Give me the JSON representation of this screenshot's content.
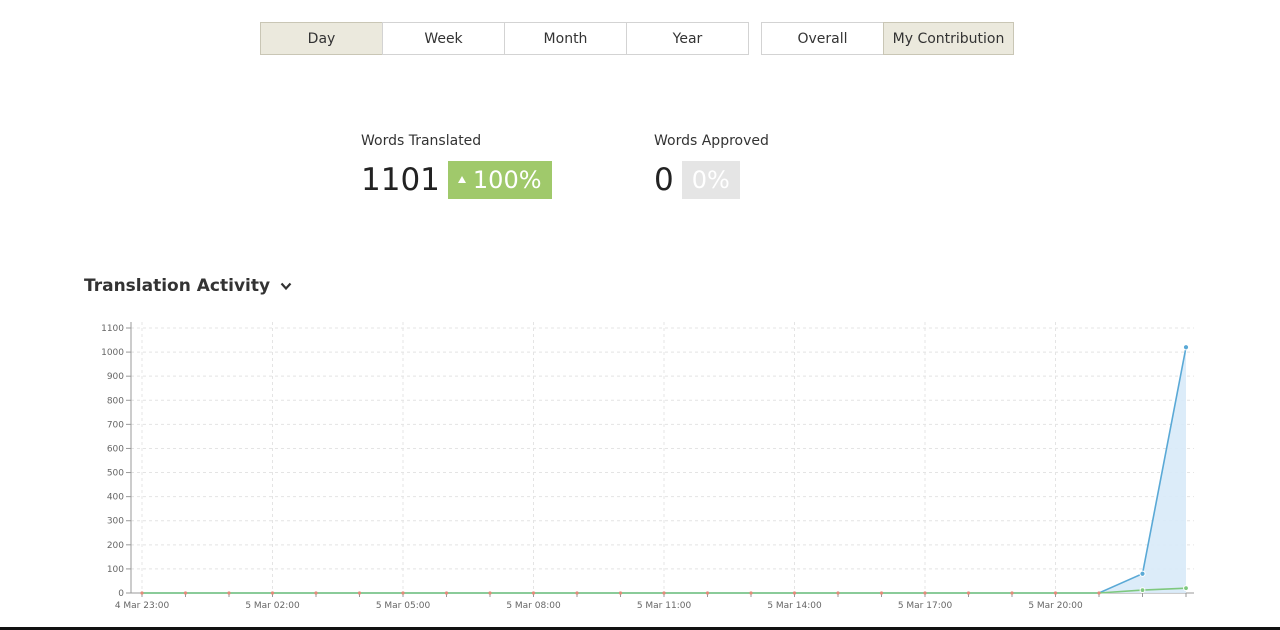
{
  "period_buttons": [
    {
      "label": "Day",
      "active": true
    },
    {
      "label": "Week",
      "active": false
    },
    {
      "label": "Month",
      "active": false
    },
    {
      "label": "Year",
      "active": false
    }
  ],
  "scope_buttons": [
    {
      "label": "Overall",
      "active": false
    },
    {
      "label": "My Contribution",
      "active": true
    }
  ],
  "stats": {
    "translated": {
      "label": "Words Translated",
      "value": "1101",
      "change": "100%",
      "trend": "up"
    },
    "approved": {
      "label": "Words Approved",
      "value": "0",
      "change": "0%",
      "trend": "none"
    }
  },
  "section": {
    "title": "Translation Activity",
    "chevron_icon": "chevron-down-icon"
  },
  "colors": {
    "active_button": "#ebe9dd",
    "badge_green": "#a0c96b",
    "badge_grey": "#e5e5e5",
    "series_translated": "#5aa9d6",
    "series_translated_fill": "#d8eaf8",
    "series_approved": "#7ec87e",
    "baseline_markers": "#e28b7a"
  },
  "chart_data": {
    "type": "area",
    "xlabel": "",
    "ylabel": "",
    "ylim": [
      0,
      1100
    ],
    "y_ticks": [
      0,
      100,
      200,
      300,
      400,
      500,
      600,
      700,
      800,
      900,
      1000,
      1100
    ],
    "x_tick_labels": [
      "4 Mar 23:00",
      "5 Mar 02:00",
      "5 Mar 05:00",
      "5 Mar 08:00",
      "5 Mar 11:00",
      "5 Mar 14:00",
      "5 Mar 17:00",
      "5 Mar 20:00"
    ],
    "x_hours": [
      0,
      1,
      2,
      3,
      4,
      5,
      6,
      7,
      8,
      9,
      10,
      11,
      12,
      13,
      14,
      15,
      16,
      17,
      18,
      19,
      20,
      21,
      22,
      23,
      24
    ],
    "series": [
      {
        "values": [
          0,
          0,
          0,
          0,
          0,
          0,
          0,
          0,
          0,
          0,
          0,
          0,
          0,
          0,
          0,
          0,
          0,
          0,
          0,
          0,
          0,
          0,
          0,
          80,
          1020
        ]
      },
      {
        "values": [
          0,
          0,
          0,
          0,
          0,
          0,
          0,
          0,
          0,
          0,
          0,
          0,
          0,
          0,
          0,
          0,
          0,
          0,
          0,
          0,
          0,
          0,
          0,
          12,
          20
        ]
      }
    ]
  }
}
